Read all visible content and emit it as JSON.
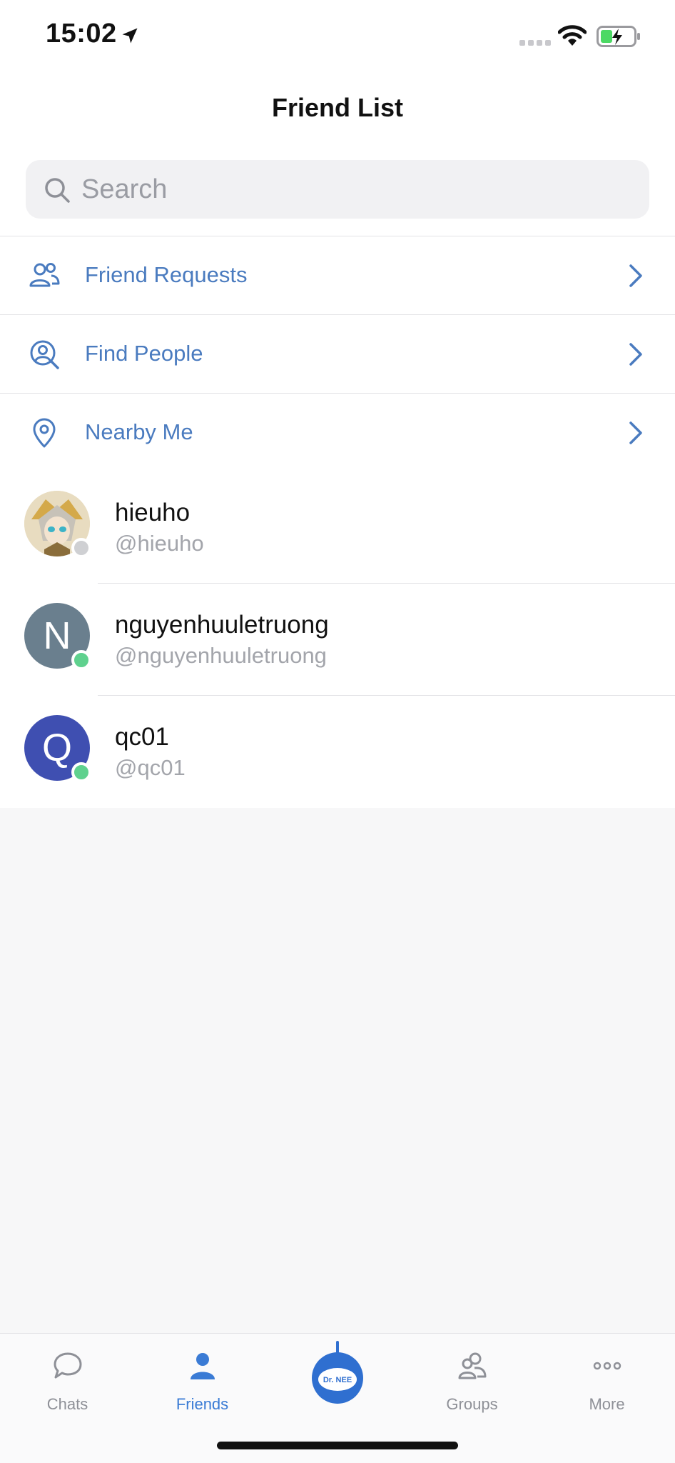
{
  "status": {
    "time": "15:02"
  },
  "header": {
    "title": "Friend List"
  },
  "search": {
    "placeholder": "Search"
  },
  "menu": [
    {
      "label": "Friend Requests",
      "icon": "friend-requests-icon"
    },
    {
      "label": "Find People",
      "icon": "find-people-icon"
    },
    {
      "label": "Nearby Me",
      "icon": "location-pin-icon"
    }
  ],
  "friends": [
    {
      "name": "hieuho",
      "handle": "@hieuho",
      "initial": "",
      "avatar_color": "#c9b07a",
      "online": false
    },
    {
      "name": "nguyenhuuletruong",
      "handle": "@nguyenhuuletruong",
      "initial": "N",
      "avatar_color": "#6a7f8e",
      "online": true
    },
    {
      "name": "qc01",
      "handle": "@qc01",
      "initial": "Q",
      "avatar_color": "#3f4fb1",
      "online": true
    }
  ],
  "tabs": [
    {
      "label": "Chats",
      "icon": "chat-bubble-icon",
      "active": false
    },
    {
      "label": "Friends",
      "icon": "person-icon",
      "active": true
    },
    {
      "label": "Dr. NEE",
      "icon": "bot-logo-icon",
      "active": false
    },
    {
      "label": "Groups",
      "icon": "group-icon",
      "active": false
    },
    {
      "label": "More",
      "icon": "more-dots-icon",
      "active": false
    }
  ],
  "colors": {
    "accent": "#3a7bd5",
    "menu_text": "#4a7bbf",
    "online": "#5fd18e",
    "offline": "#cfd0d3"
  }
}
